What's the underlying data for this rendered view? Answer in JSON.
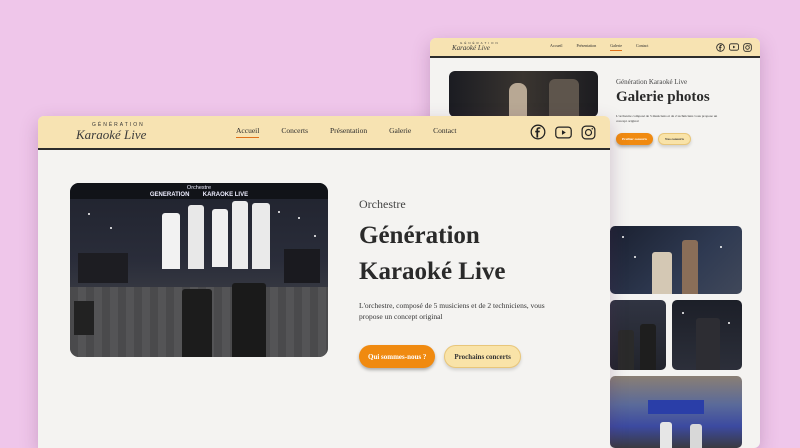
{
  "site": {
    "logo_top": "GÉNÉRATION",
    "logo_name": "Karaoké Live",
    "nav": [
      {
        "label": "Accueil"
      },
      {
        "label": "Concerts"
      },
      {
        "label": "Présentation"
      },
      {
        "label": "Galerie"
      },
      {
        "label": "Contact"
      }
    ],
    "social": [
      "facebook-icon",
      "youtube-icon",
      "instagram-icon"
    ]
  },
  "home": {
    "photo_banner": "GENERATION        KARAOKE LIVE",
    "photo_banner_top": "Orchestre",
    "subtitle": "Orchestre",
    "title_line1": "Génération",
    "title_line2": "Karaoké Live",
    "description": "L'orchestre, composé de 5 musiciens et de 2 techniciens, vous propose un concept original",
    "btn_primary": "Qui sommes-nous ?",
    "btn_secondary": "Prochains concerts",
    "active_nav": "Accueil"
  },
  "gallery": {
    "nav": [
      {
        "label": "Accueil"
      },
      {
        "label": "Présentation"
      },
      {
        "label": "Galerie"
      },
      {
        "label": "Contact"
      }
    ],
    "active_nav": "Galerie",
    "subtitle": "Génération Karaoké Live",
    "title": "Galerie photos",
    "description": "L'orchestre composé de 5 musiciens et de 2 techniciens vous propose un concept original",
    "btn_primary": "Profiter concerts",
    "btn_secondary": "Nos concerts"
  },
  "colors": {
    "background": "#efc6ea",
    "nav_bg": "#f7e3b2",
    "accent": "#f08a10",
    "secondary_btn": "#f9e3a8"
  }
}
